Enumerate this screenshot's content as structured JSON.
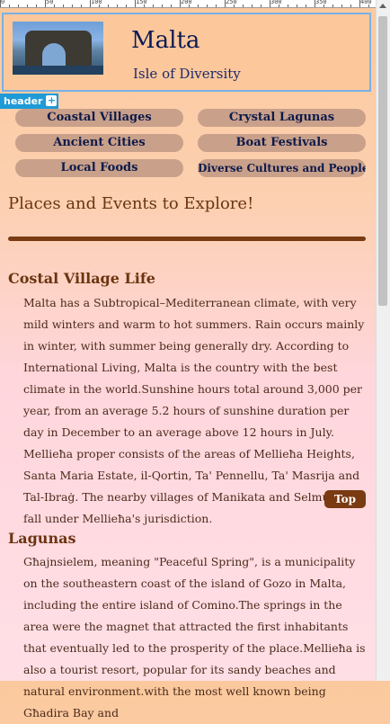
{
  "ruler": {
    "labels": [
      "0",
      "50",
      "100",
      "150",
      "200",
      "250",
      "300",
      "350",
      "400"
    ]
  },
  "header": {
    "title": "Malta",
    "subtitle": "Isle of Diversity",
    "tag_label": "header",
    "tag_plus": "+"
  },
  "nav": {
    "items": [
      {
        "label": "Coastal Villages"
      },
      {
        "label": "Crystal Lagunas"
      },
      {
        "label": "Ancient Cities"
      },
      {
        "label": "Boat Festivals"
      },
      {
        "label": "Local Foods"
      },
      {
        "label": "Diverse Cultures and People"
      }
    ]
  },
  "main": {
    "lead": "Places and Events to Explore!",
    "articles": [
      {
        "title": "Costal Village Life",
        "body": "Malta has a Subtropical–Mediterranean climate, with very mild winters and warm to hot summers. Rain occurs mainly in winter, with summer being generally dry. According to International Living, Malta is the country with the best climate in the world.Sunshine hours total around 3,000 per year, from an average 5.2 hours of sunshine duration per day in December to an average above 12 hours in July. Mellieħa proper consists of the areas of Mellieħa Heights, Santa Maria Estate, il-Qortin, Ta' Pennellu, Ta' Masrija and Tal-Ibraġ. The nearby villages of Manikata and Selmun also fall under Mellieħa's jurisdiction."
      },
      {
        "title": "Lagunas",
        "body": "Għajnsielem, meaning \"Peaceful Spring\", is a municipality on the southeastern coast of the island of Gozo in Malta, including the entire island of Comino.The springs in the area were the magnet that attracted the first inhabitants that eventually led to the prosperity of the place.Mellieħa is also a tourist resort, popular for its sandy beaches and natural environment.with the most well known being Għadira Bay and"
      }
    ],
    "top_label": "Top"
  },
  "colors": {
    "accent": "#7a3a12",
    "heading": "#6b3410",
    "nav_bg": "#c9a08a",
    "header_bg": "#fcc89b"
  }
}
